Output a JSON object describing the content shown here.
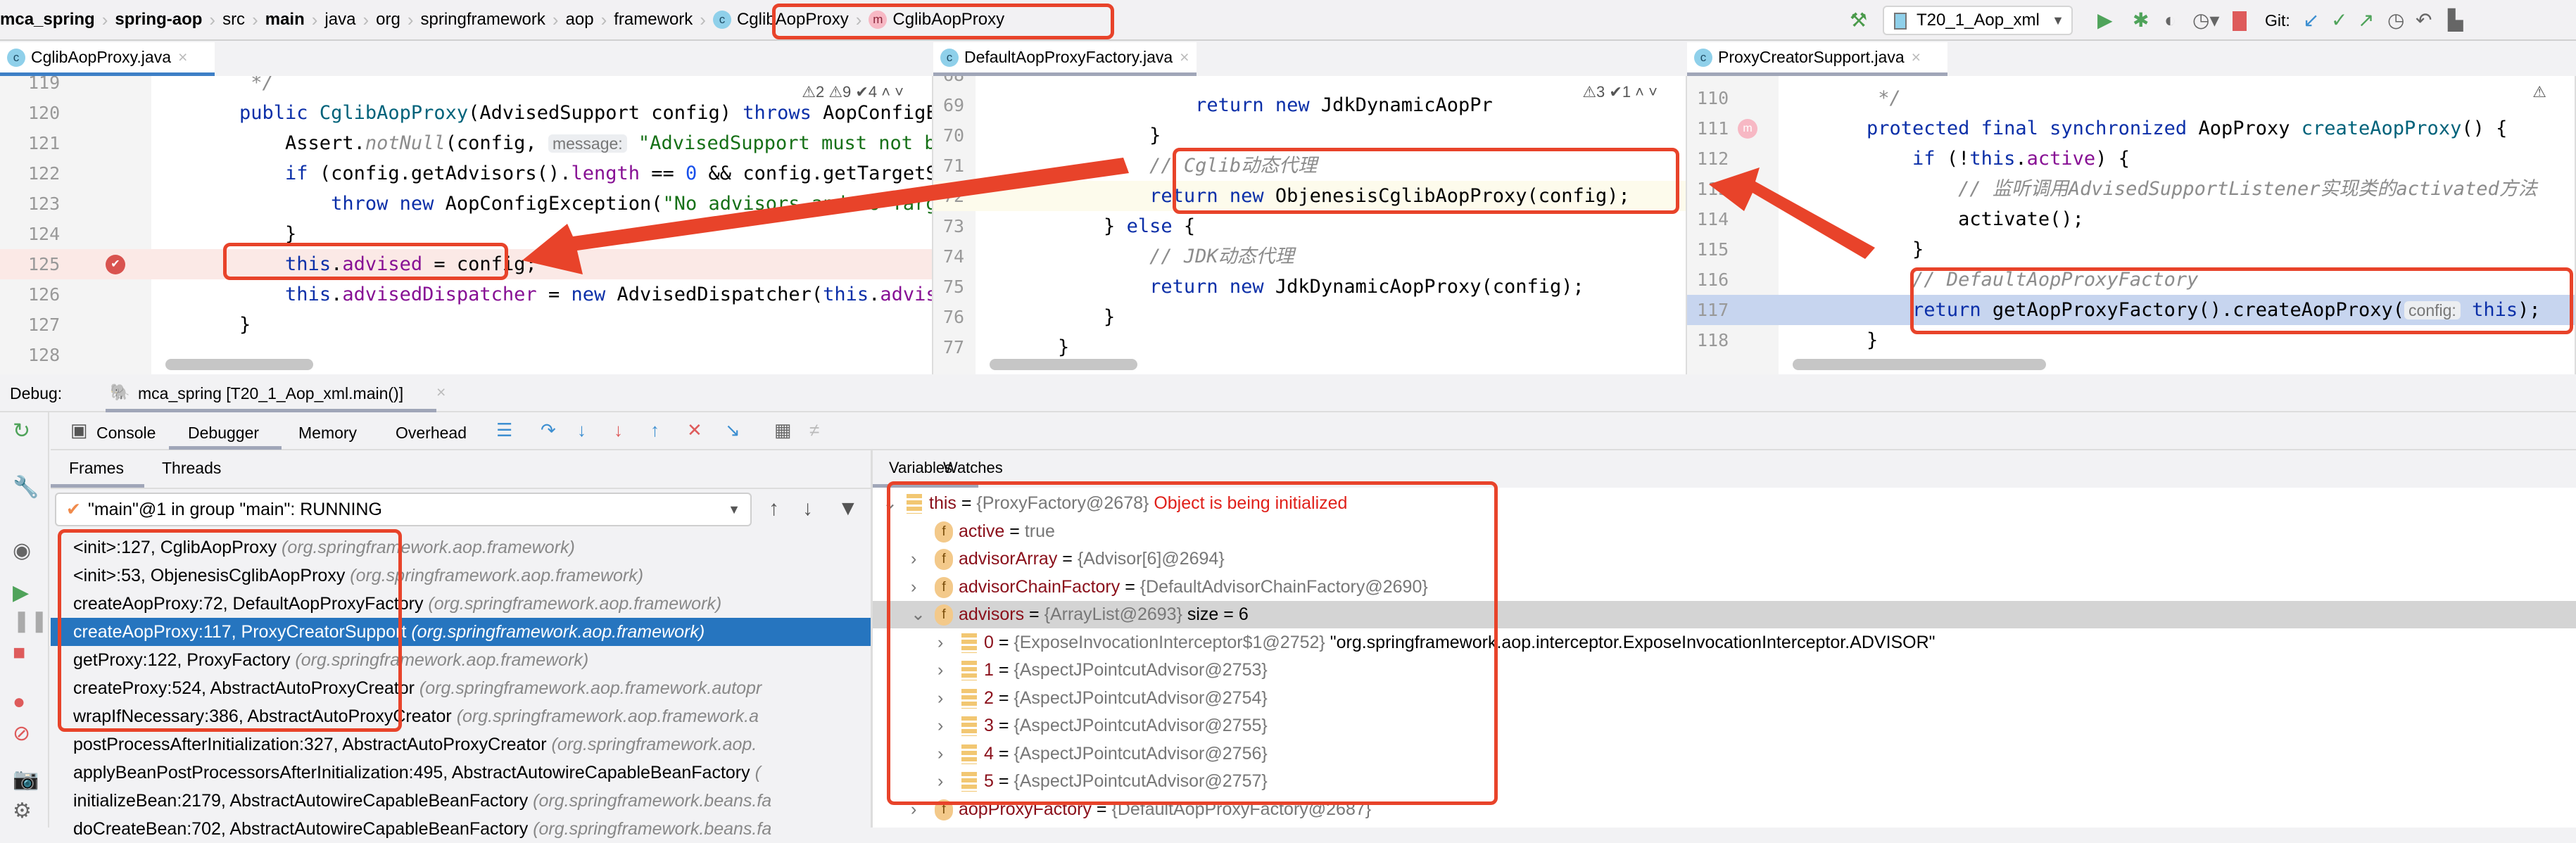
{
  "breadcrumb": [
    {
      "label": "mca_spring",
      "bold": true
    },
    {
      "label": "spring-aop",
      "bold": true
    },
    {
      "label": "src"
    },
    {
      "label": "main",
      "bold": true
    },
    {
      "label": "java"
    },
    {
      "label": "org"
    },
    {
      "label": "springframework"
    },
    {
      "label": "aop"
    },
    {
      "label": "framework"
    },
    {
      "label": "CglibAopProxy",
      "icon": "class-icon",
      "badge": "c"
    },
    {
      "label": "CglibAopProxy",
      "icon": "method-icon",
      "badge": "m"
    }
  ],
  "toolbar": {
    "run_config": "T20_1_Aop_xml",
    "git_label": "Git:"
  },
  "editor_tabs": [
    "CglibAopProxy.java",
    "DefaultAopProxyFactory.java",
    "ProxyCreatorSupport.java"
  ],
  "panes": [
    {
      "inspection": "⚠2  ⚠9  ✔4  ˄  ˅",
      "lines": [
        {
          "n": "119",
          "c": [
            [
              "cmt",
              "     */"
            ]
          ]
        },
        {
          "n": "120",
          "c": [
            [
              "",
              "    "
            ],
            [
              "kw",
              "public "
            ],
            [
              "mth",
              "CglibAopProxy"
            ],
            [
              "",
              "(AdvisedSupport config) "
            ],
            [
              "kw",
              "throws "
            ],
            [
              "",
              "AopConfigExcep"
            ]
          ]
        },
        {
          "n": "121",
          "c": [
            [
              "",
              "        Assert."
            ],
            [
              "cmt",
              "notNull"
            ],
            [
              "",
              "(config, "
            ],
            [
              "hint",
              "message:"
            ],
            [
              "str",
              " \"AdvisedSupport must not be n"
            ]
          ]
        },
        {
          "n": "122",
          "c": [
            [
              "",
              "        "
            ],
            [
              "kw",
              "if "
            ],
            [
              "",
              "(config.getAdvisors()."
            ],
            [
              "fld",
              "length"
            ],
            [
              "",
              " == "
            ],
            [
              "num",
              "0"
            ],
            [
              "",
              " && config.getTargetSource"
            ]
          ]
        },
        {
          "n": "123",
          "c": [
            [
              "",
              "            "
            ],
            [
              "kw",
              "throw new "
            ],
            [
              "",
              "AopConfigException("
            ],
            [
              "str",
              "\"No advisors and no Targe"
            ]
          ]
        },
        {
          "n": "124",
          "c": [
            [
              "",
              "        }"
            ]
          ]
        },
        {
          "n": "125",
          "c": [
            [
              "",
              "        "
            ],
            [
              "kw",
              "this"
            ],
            [
              "",
              "."
            ],
            [
              "fld",
              "advised"
            ],
            [
              "",
              " = config;"
            ]
          ]
        },
        {
          "n": "126",
          "c": [
            [
              "",
              "        "
            ],
            [
              "kw",
              "this"
            ],
            [
              "",
              "."
            ],
            [
              "fld",
              "advisedDispatcher"
            ],
            [
              "",
              " = "
            ],
            [
              "kw",
              "new "
            ],
            [
              "",
              "AdvisedDispatcher("
            ],
            [
              "kw",
              "this"
            ],
            [
              "",
              "."
            ],
            [
              "fld",
              "advised"
            ],
            [
              "",
              ");"
            ]
          ]
        },
        {
          "n": "127",
          "c": [
            [
              "",
              "    }"
            ]
          ]
        },
        {
          "n": "128",
          "c": [
            [
              "",
              ""
            ]
          ]
        }
      ]
    },
    {
      "inspection": "⚠3  ✔1  ˄  ˅",
      "lines": [
        {
          "n": "68",
          "c": [
            [
              "",
              ""
            ]
          ]
        },
        {
          "n": "69",
          "c": [
            [
              "",
              "                "
            ],
            [
              "kw",
              "return new "
            ],
            [
              "",
              "JdkDynamicAopPr"
            ]
          ]
        },
        {
          "n": "70",
          "c": [
            [
              "",
              "            }"
            ]
          ]
        },
        {
          "n": "71",
          "c": [
            [
              "cmt",
              "            // Cglib动态代理"
            ]
          ]
        },
        {
          "n": "72",
          "c": [
            [
              "",
              "            "
            ],
            [
              "kw",
              "return new "
            ],
            [
              "",
              "ObjenesisCglibAopProxy(config);"
            ]
          ]
        },
        {
          "n": "73",
          "c": [
            [
              "",
              "        } "
            ],
            [
              "kw",
              "else "
            ],
            [
              "",
              "{"
            ]
          ]
        },
        {
          "n": "74",
          "c": [
            [
              "cmt",
              "            // JDK动态代理"
            ]
          ]
        },
        {
          "n": "75",
          "c": [
            [
              "",
              "            "
            ],
            [
              "kw",
              "return new "
            ],
            [
              "",
              "JdkDynamicAopProxy(config);"
            ]
          ]
        },
        {
          "n": "76",
          "c": [
            [
              "",
              "        }"
            ]
          ]
        },
        {
          "n": "77",
          "c": [
            [
              "",
              "    }"
            ]
          ]
        }
      ]
    },
    {
      "inspection": "⚠",
      "lines": [
        {
          "n": "110",
          "c": [
            [
              "cmt",
              "     */"
            ]
          ]
        },
        {
          "n": "111",
          "c": [
            [
              "",
              "    "
            ],
            [
              "kw",
              "protected final synchronized "
            ],
            [
              "",
              "AopProxy "
            ],
            [
              "mth",
              "createAopProxy"
            ],
            [
              "",
              "() {"
            ]
          ]
        },
        {
          "n": "112",
          "c": [
            [
              "",
              "        "
            ],
            [
              "kw",
              "if "
            ],
            [
              "",
              "(!"
            ],
            [
              "kw",
              "this"
            ],
            [
              "",
              "."
            ],
            [
              "fld",
              "active"
            ],
            [
              "",
              ") {"
            ]
          ]
        },
        {
          "n": "113",
          "c": [
            [
              "cmt",
              "            // 监听调用AdvisedSupportListener实现类的activated方法"
            ]
          ]
        },
        {
          "n": "114",
          "c": [
            [
              "",
              "            activate();"
            ]
          ]
        },
        {
          "n": "115",
          "c": [
            [
              "",
              "        }"
            ]
          ]
        },
        {
          "n": "116",
          "c": [
            [
              "cmt",
              "        // DefaultAopProxyFactory"
            ]
          ]
        },
        {
          "n": "117",
          "c": [
            [
              "",
              "        "
            ],
            [
              "kw",
              "return "
            ],
            [
              "",
              "getAopProxyFactory().createAopProxy("
            ],
            [
              "hint",
              "config:"
            ],
            [
              "kw",
              " this"
            ],
            [
              "",
              ");"
            ]
          ]
        },
        {
          "n": "118",
          "c": [
            [
              "",
              "    }"
            ]
          ]
        }
      ]
    }
  ],
  "debug": {
    "label": "Debug:",
    "session": "mca_spring [T20_1_Aop_xml.main()]",
    "tabs": [
      "Console",
      "Debugger",
      "Memory",
      "Overhead"
    ],
    "active_tab": "Debugger",
    "subtabs": [
      "Frames",
      "Threads"
    ],
    "thread": "\"main\"@1 in group \"main\": RUNNING",
    "frames": [
      {
        "m": "<init>:127, CglibAopProxy",
        "p": "(org.springframework.aop.framework)"
      },
      {
        "m": "<init>:53, ObjenesisCglibAopProxy",
        "p": "(org.springframework.aop.framework)"
      },
      {
        "m": "createAopProxy:72, DefaultAopProxyFactory",
        "p": "(org.springframework.aop.framework)"
      },
      {
        "m": "createAopProxy:117, ProxyCreatorSupport",
        "p": "(org.springframework.aop.framework)",
        "selected": true
      },
      {
        "m": "getProxy:122, ProxyFactory",
        "p": "(org.springframework.aop.framework)"
      },
      {
        "m": "createProxy:524, AbstractAutoProxyCreator",
        "p": "(org.springframework.aop.framework.autopr"
      },
      {
        "m": "wrapIfNecessary:386, AbstractAutoProxyCreator",
        "p": "(org.springframework.aop.framework.a"
      },
      {
        "m": "postProcessAfterInitialization:327, AbstractAutoProxyCreator",
        "p": "(org.springframework.aop."
      },
      {
        "m": "applyBeanPostProcessorsAfterInitialization:495, AbstractAutowireCapableBeanFactory",
        "p": "("
      },
      {
        "m": "initializeBean:2179, AbstractAutowireCapableBeanFactory",
        "p": "(org.springframework.beans.fa"
      },
      {
        "m": "doCreateBean:702, AbstractAutowireCapableBeanFactory",
        "p": "(org.springframework.beans.fa"
      }
    ],
    "var_tabs": [
      "Variables",
      "Watches"
    ],
    "variables": [
      {
        "lvl": 0,
        "exp": "v",
        "icon": "list",
        "name": "this",
        "val": "{ProxyFactory@2678}",
        "note": "Object is being initialized"
      },
      {
        "lvl": 1,
        "exp": "",
        "icon": "f",
        "name": "active",
        "val": "true"
      },
      {
        "lvl": 1,
        "exp": ">",
        "icon": "f",
        "name": "advisorArray",
        "val": "{Advisor[6]@2694}"
      },
      {
        "lvl": 1,
        "exp": ">",
        "icon": "f",
        "name": "advisorChainFactory",
        "val": "{DefaultAdvisorChainFactory@2690}"
      },
      {
        "lvl": 1,
        "exp": "v",
        "icon": "f",
        "name": "advisors",
        "val": "{ArrayList@2693}",
        "extra": "size = 6",
        "hl": true
      },
      {
        "lvl": 2,
        "exp": ">",
        "icon": "list",
        "name": "0",
        "val": "{ExposeInvocationInterceptor$1@2752}",
        "extra": "\"org.springframework.aop.interceptor.ExposeInvocationInterceptor.ADVISOR\""
      },
      {
        "lvl": 2,
        "exp": ">",
        "icon": "list",
        "name": "1",
        "val": "{AspectJPointcutAdvisor@2753}"
      },
      {
        "lvl": 2,
        "exp": ">",
        "icon": "list",
        "name": "2",
        "val": "{AspectJPointcutAdvisor@2754}"
      },
      {
        "lvl": 2,
        "exp": ">",
        "icon": "list",
        "name": "3",
        "val": "{AspectJPointcutAdvisor@2755}"
      },
      {
        "lvl": 2,
        "exp": ">",
        "icon": "list",
        "name": "4",
        "val": "{AspectJPointcutAdvisor@2756}"
      },
      {
        "lvl": 2,
        "exp": ">",
        "icon": "list",
        "name": "5",
        "val": "{AspectJPointcutAdvisor@2757}"
      },
      {
        "lvl": 1,
        "exp": ">",
        "icon": "f",
        "name": "aopProxyFactory",
        "val": "{DefaultAopProxyFactory@2687}"
      }
    ]
  },
  "colors": {
    "annotation": "#e8432a",
    "selection": "#2675bf",
    "keyword": "#0b2fa8",
    "field": "#871094",
    "string": "#167017"
  }
}
